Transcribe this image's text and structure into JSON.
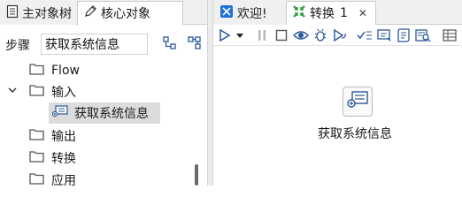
{
  "left_panel": {
    "tabs": [
      {
        "label": "主对象树",
        "icon": "list-icon",
        "active": false
      },
      {
        "label": "核心对象",
        "icon": "pencil-icon",
        "active": true
      }
    ],
    "step_label": "步骤",
    "step_search_value": "获取系统信息",
    "tree": [
      {
        "label": "Flow",
        "expanded": false
      },
      {
        "label": "输入",
        "expanded": true,
        "children": [
          {
            "label": "获取系统信息",
            "selected": true,
            "icon": "system-info-icon"
          }
        ]
      },
      {
        "label": "输出",
        "expanded": false
      },
      {
        "label": "转换",
        "expanded": false
      },
      {
        "label": "应用",
        "expanded": false
      }
    ]
  },
  "right_panel": {
    "tabs": [
      {
        "label": "欢迎!",
        "icon": "welcome-icon",
        "active": false
      },
      {
        "label": "转换",
        "number": "1",
        "close": "✕",
        "icon": "transform-icon",
        "active": true
      }
    ],
    "toolbar": [
      "run-icon",
      "run-dropdown-icon",
      "pause-icon",
      "stop-icon",
      "preview-icon",
      "debug-icon",
      "replay-icon",
      "verify-icon",
      "impact-icon",
      "sql-icon",
      "explore-db-icon",
      "grid-icon"
    ],
    "canvas_node": {
      "label": "获取系统信息",
      "icon": "system-info-icon"
    }
  },
  "colors": {
    "accent_green": "#2e9d3e",
    "folder": "#5a5a5a",
    "icon_blue": "#2b5797"
  }
}
